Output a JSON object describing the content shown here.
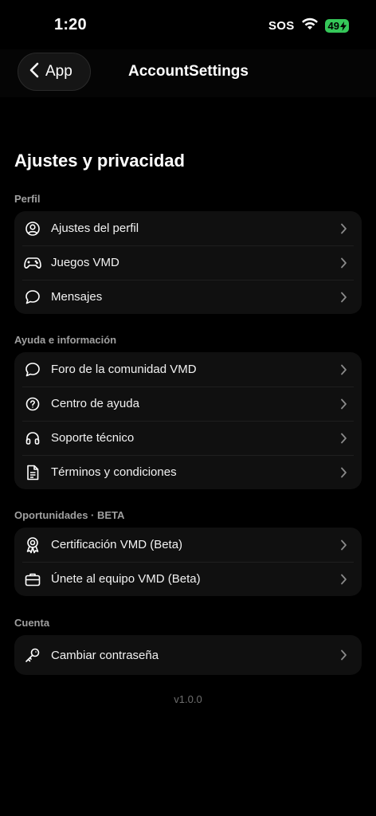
{
  "status_bar": {
    "time": "1:20",
    "sos": "SOS",
    "battery": "49"
  },
  "nav": {
    "back_label": "App",
    "title": "AccountSettings"
  },
  "page": {
    "heading": "Ajustes y privacidad"
  },
  "sections": {
    "perfil": {
      "label": "Perfil",
      "items": [
        {
          "label": "Ajustes del perfil",
          "icon": "user-circle-icon"
        },
        {
          "label": "Juegos VMD",
          "icon": "gamepad-icon"
        },
        {
          "label": "Mensajes",
          "icon": "chat-bubble-icon"
        }
      ]
    },
    "ayuda": {
      "label": "Ayuda e información",
      "items": [
        {
          "label": "Foro de la comunidad VMD",
          "icon": "chat-bubble-icon"
        },
        {
          "label": "Centro de ayuda",
          "icon": "help-circle-icon"
        },
        {
          "label": "Soporte técnico",
          "icon": "headphones-icon"
        },
        {
          "label": "Términos y condiciones",
          "icon": "document-icon"
        }
      ]
    },
    "oportunidades": {
      "label": "Oportunidades · BETA",
      "items": [
        {
          "label": "Certificación VMD (Beta)",
          "icon": "award-icon"
        },
        {
          "label": "Únete al equipo VMD (Beta)",
          "icon": "briefcase-icon"
        }
      ]
    },
    "cuenta": {
      "label": "Cuenta",
      "items": [
        {
          "label": "Cambiar contraseña",
          "icon": "key-icon"
        }
      ]
    }
  },
  "footer": {
    "version": "v1.0.0"
  },
  "colors": {
    "background": "#000000",
    "card": "#101010",
    "battery": "#35c759",
    "section_label": "#a0a0a0"
  }
}
